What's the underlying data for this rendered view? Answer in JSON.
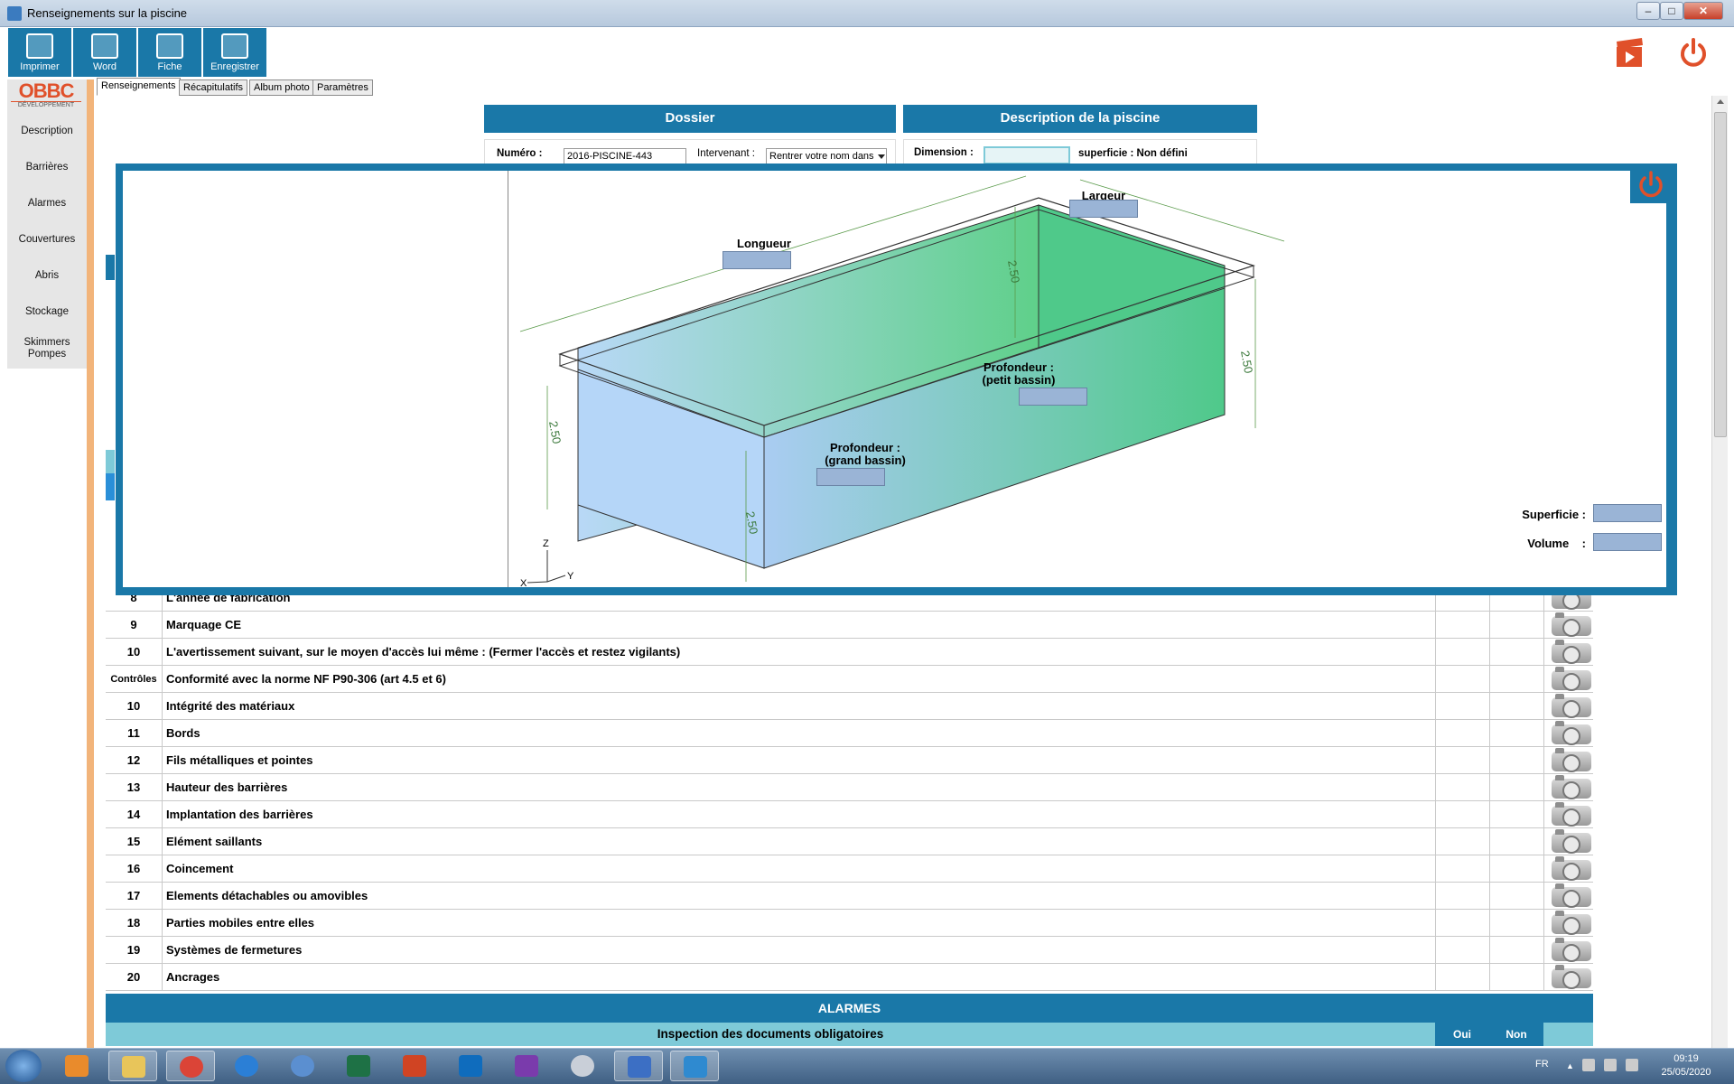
{
  "window": {
    "title": "Renseignements sur la piscine",
    "btn_min": "–",
    "btn_max": "□",
    "btn_close": "✕"
  },
  "toolbar": {
    "items": [
      {
        "label": "Imprimer",
        "icon": "printer-icon"
      },
      {
        "label": "Word",
        "icon": "word-icon"
      },
      {
        "label": "Fiche",
        "icon": "document-edit-icon"
      },
      {
        "label": "Enregistrer",
        "icon": "save-icon"
      }
    ]
  },
  "logo": {
    "brand": "OBBC",
    "sub": "DÉVELOPPEMENT"
  },
  "sidebar": {
    "items": [
      "Description",
      "Barrières",
      "Alarmes",
      "Couvertures",
      "Abris",
      "Stockage",
      "Skimmers\nPompes"
    ]
  },
  "tabs": [
    "Renseignements",
    "Récapitulatifs",
    "Album photo",
    "Paramètres"
  ],
  "dossier": {
    "title": "Dossier",
    "numero_label": "Numéro :",
    "numero_value": "2016-PISCINE-443",
    "intervenant_label": "Intervenant :",
    "intervenant_value": "Rentrer votre nom dans"
  },
  "description": {
    "title": "Description de la piscine",
    "dimension_label": "Dimension :",
    "superficie_text": "superficie : Non défini"
  },
  "modal": {
    "longueur": "Longueur",
    "largeur": "Largeur",
    "prof_petit": "Profondeur :\n(petit bassin)",
    "prof_grand": "Profondeur :\n(grand bassin)",
    "superficie": "Superficie :",
    "volume": "Volume    :",
    "dim_250": "2.50",
    "axis_z": "Z",
    "axis_y": "Y",
    "axis_x": "X"
  },
  "table": {
    "rows": [
      {
        "num": "8",
        "text": "L'année de fabrication"
      },
      {
        "num": "9",
        "text": "Marquage CE"
      },
      {
        "num": "10",
        "text": "L'avertissement suivant, sur le moyen d'accès lui même : (Fermer l'accès et restez vigilants)"
      },
      {
        "num": "Contrôles",
        "text": "Conformité avec la norme NF P90-306 (art 4.5 et 6)"
      },
      {
        "num": "10",
        "text": "Intégrité des matériaux"
      },
      {
        "num": "11",
        "text": "Bords"
      },
      {
        "num": "12",
        "text": "Fils métalliques et pointes"
      },
      {
        "num": "13",
        "text": "Hauteur des barrières"
      },
      {
        "num": "14",
        "text": "Implantation des barrières"
      },
      {
        "num": "15",
        "text": "Elément saillants"
      },
      {
        "num": "16",
        "text": "Coincement"
      },
      {
        "num": "17",
        "text": "Elements détachables ou amovibles"
      },
      {
        "num": "18",
        "text": "Parties mobiles entre elles"
      },
      {
        "num": "19",
        "text": "Systèmes de fermetures"
      },
      {
        "num": "20",
        "text": "Ancrages"
      }
    ]
  },
  "alarmes": {
    "title": "ALARMES",
    "inspection": "Inspection des documents obligatoires",
    "oui": "Oui",
    "non": "Non"
  },
  "taskbar": {
    "lang": "FR",
    "time": "09:19",
    "date": "25/05/2020"
  },
  "colors": {
    "accent": "#1a78a8",
    "sidebar_orange": "#f2b47a",
    "light_teal": "#7ecad8",
    "red_power": "#e0502a"
  }
}
